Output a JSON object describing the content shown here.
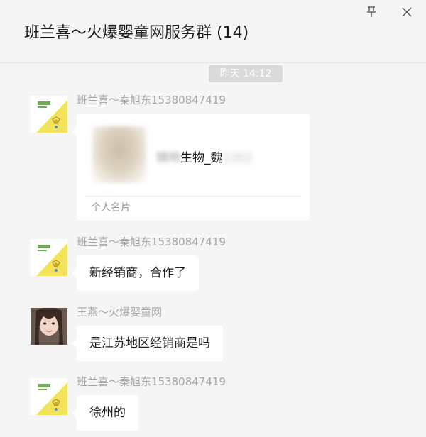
{
  "header": {
    "title": "班兰喜～火爆婴童网服务群 (14)",
    "pin_icon": "pin-icon",
    "close_icon": "close-icon"
  },
  "timestamp": "昨天 14:12",
  "messages": [
    {
      "sender": "班兰喜～秦旭东15380847419",
      "type": "contact-card",
      "card_name": "锦帅生物_魏",
      "card_name_visible": "生物_魏",
      "card_label": "个人名片"
    },
    {
      "sender": "班兰喜～秦旭东15380847419",
      "type": "text",
      "text": "新经销商，合作了"
    },
    {
      "sender": "王燕～火爆婴童网",
      "type": "text",
      "text": "是江苏地区经销商是吗"
    },
    {
      "sender": "班兰喜～秦旭东15380847419",
      "type": "text",
      "text": "徐州的"
    }
  ],
  "colors": {
    "background": "#f5f5f5",
    "bubble": "#ffffff",
    "sender_text": "#a5a5a5",
    "avatar_yellow": "#f2e35a"
  }
}
